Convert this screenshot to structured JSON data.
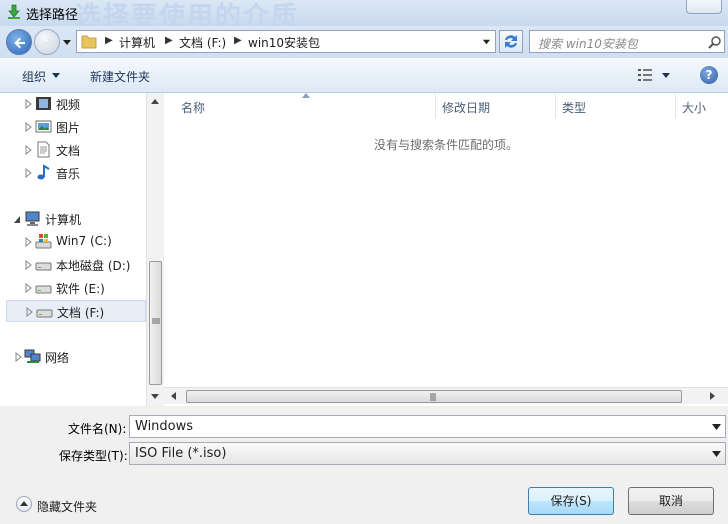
{
  "window": {
    "title": "选择路径",
    "watermark": "选择要使用的介质"
  },
  "nav": {
    "breadcrumb": [
      "计算机",
      "文档 (F:)",
      "win10安装包"
    ],
    "search_placeholder": "搜索 win10安装包"
  },
  "toolbar": {
    "organize": "组织",
    "new_folder": "新建文件夹"
  },
  "tree": {
    "items": [
      {
        "label": "视频",
        "icon": "video-library-icon"
      },
      {
        "label": "图片",
        "icon": "pictures-library-icon"
      },
      {
        "label": "文档",
        "icon": "documents-library-icon"
      },
      {
        "label": "音乐",
        "icon": "music-library-icon"
      },
      {
        "label": "计算机",
        "icon": "computer-icon"
      },
      {
        "label": "Win7 (C:)",
        "icon": "system-drive-icon"
      },
      {
        "label": "本地磁盘 (D:)",
        "icon": "drive-icon"
      },
      {
        "label": "软件 (E:)",
        "icon": "drive-icon"
      },
      {
        "label": "文档 (F:)",
        "icon": "drive-icon",
        "selected": true
      },
      {
        "label": "网络",
        "icon": "network-icon"
      }
    ]
  },
  "filelist": {
    "columns": [
      "名称",
      "修改日期",
      "类型",
      "大小"
    ],
    "empty_message": "没有与搜索条件匹配的项。"
  },
  "form": {
    "filename_label": "文件名(N):",
    "filename_value": "Windows",
    "filetype_label": "保存类型(T):",
    "filetype_value": "ISO File (*.iso)"
  },
  "footer": {
    "hide_folders": "隐藏文件夹",
    "save": "保存(S)",
    "cancel": "取消"
  }
}
